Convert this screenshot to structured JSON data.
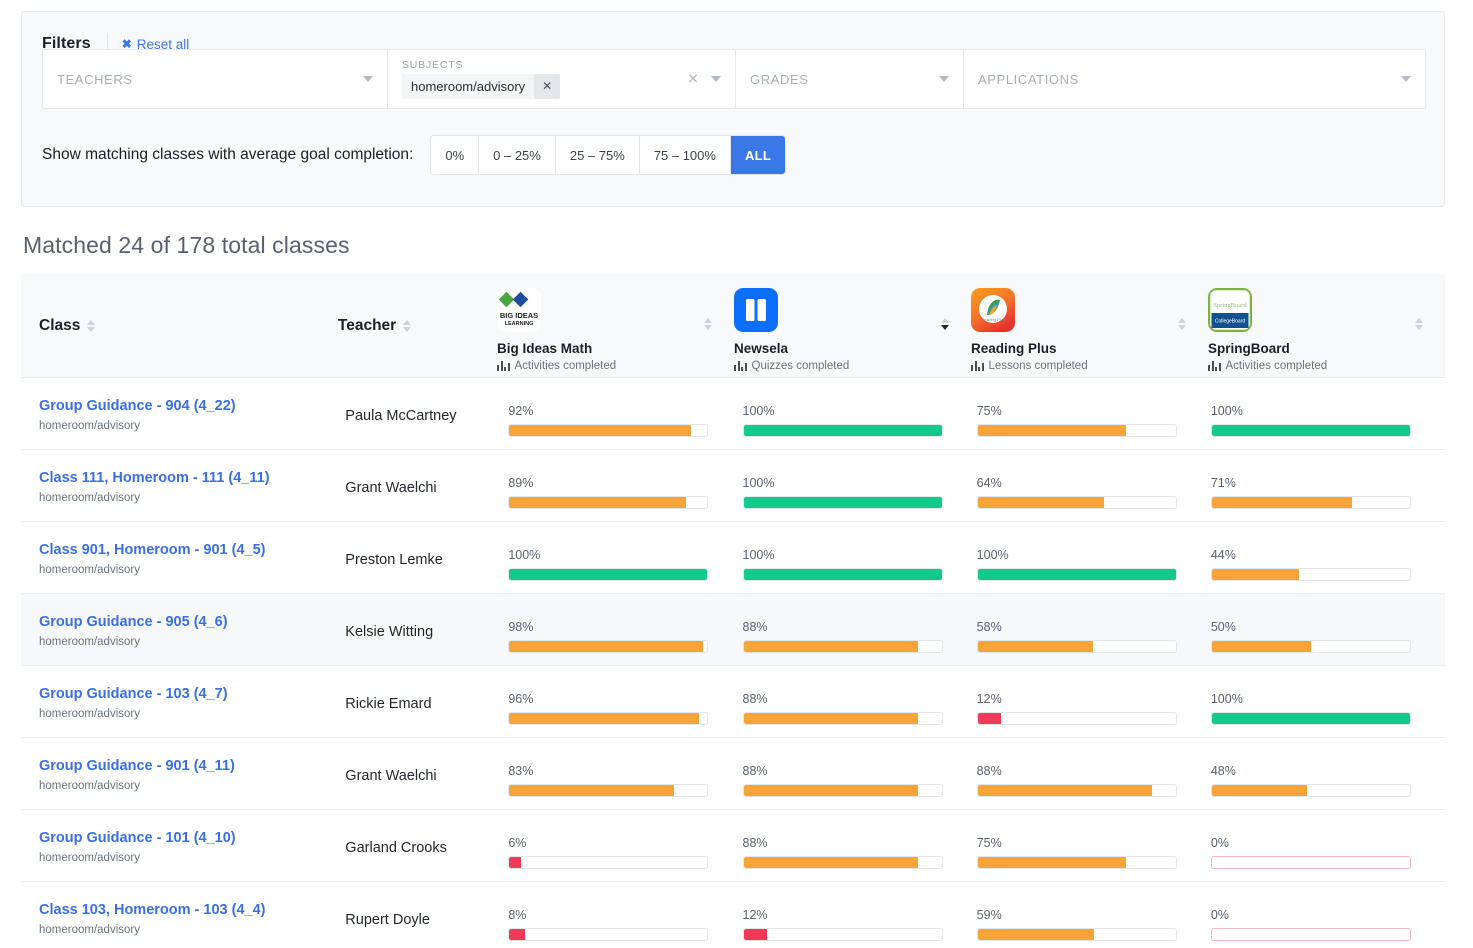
{
  "filters": {
    "title": "Filters",
    "reset_label": "Reset all",
    "reset_icon": "close-x-icon",
    "teachers_placeholder": "TEACHERS",
    "subjects_label": "SUBJECTS",
    "subjects_chip": "homeroom/advisory",
    "grades_placeholder": "GRADES",
    "applications_placeholder": "APPLICATIONS"
  },
  "completion": {
    "label": "Show matching classes with average goal completion:",
    "options": [
      "0%",
      "0 – 25%",
      "25 – 75%",
      "75 – 100%",
      "ALL"
    ],
    "selected": "ALL"
  },
  "results": {
    "matched_text": "Matched 24 of 178 total classes",
    "matched_count": 24,
    "total_count": 178
  },
  "colors": {
    "accent_blue": "#3b78e7",
    "link_blue": "#3b6fe0",
    "bar_orange": "#f5a43c",
    "bar_green": "#14c989",
    "bar_red": "#ef3b57",
    "zero_border": "#f0b9c3"
  },
  "table": {
    "columns": [
      {
        "key": "class",
        "label": "Class",
        "sort": "none"
      },
      {
        "key": "teacher",
        "label": "Teacher",
        "sort": "none"
      }
    ],
    "apps": [
      {
        "name": "Big Ideas Math",
        "metric": "Activities completed",
        "icon": "big-ideas-math-icon",
        "sort": "none"
      },
      {
        "name": "Newsela",
        "metric": "Quizzes completed",
        "icon": "newsela-icon",
        "sort": "desc"
      },
      {
        "name": "Reading Plus",
        "metric": "Lessons completed",
        "icon": "reading-plus-icon",
        "sort": "none"
      },
      {
        "name": "SpringBoard",
        "metric": "Activities completed",
        "icon": "springboard-icon",
        "sort": "none"
      }
    ],
    "rows": [
      {
        "class": "Group Guidance - 904 (4_22)",
        "subject": "homeroom/advisory",
        "teacher": "Paula McCartney",
        "values": [
          "92%",
          "100%",
          "75%",
          "100%"
        ],
        "pcts": [
          92,
          100,
          75,
          100
        ],
        "highlight": false
      },
      {
        "class": "Class 111, Homeroom - 111 (4_11)",
        "subject": "homeroom/advisory",
        "teacher": "Grant Waelchi",
        "values": [
          "89%",
          "100%",
          "64%",
          "71%"
        ],
        "pcts": [
          89,
          100,
          64,
          71
        ],
        "highlight": false
      },
      {
        "class": "Class 901, Homeroom - 901 (4_5)",
        "subject": "homeroom/advisory",
        "teacher": "Preston Lemke",
        "values": [
          "100%",
          "100%",
          "100%",
          "44%"
        ],
        "pcts": [
          100,
          100,
          100,
          44
        ],
        "highlight": false
      },
      {
        "class": "Group Guidance - 905 (4_6)",
        "subject": "homeroom/advisory",
        "teacher": "Kelsie Witting",
        "values": [
          "98%",
          "88%",
          "58%",
          "50%"
        ],
        "pcts": [
          98,
          88,
          58,
          50
        ],
        "highlight": true
      },
      {
        "class": "Group Guidance - 103 (4_7)",
        "subject": "homeroom/advisory",
        "teacher": "Rickie Emard",
        "values": [
          "96%",
          "88%",
          "12%",
          "100%"
        ],
        "pcts": [
          96,
          88,
          12,
          100
        ],
        "highlight": false
      },
      {
        "class": "Group Guidance - 901 (4_11)",
        "subject": "homeroom/advisory",
        "teacher": "Grant Waelchi",
        "values": [
          "83%",
          "88%",
          "88%",
          "48%"
        ],
        "pcts": [
          83,
          88,
          88,
          48
        ],
        "highlight": false
      },
      {
        "class": "Group Guidance - 101 (4_10)",
        "subject": "homeroom/advisory",
        "teacher": "Garland Crooks",
        "values": [
          "6%",
          "88%",
          "75%",
          "0%"
        ],
        "pcts": [
          6,
          88,
          75,
          0
        ],
        "highlight": false
      },
      {
        "class": "Class 103, Homeroom - 103 (4_4)",
        "subject": "homeroom/advisory",
        "teacher": "Rupert Doyle",
        "values": [
          "8%",
          "12%",
          "59%",
          "0%"
        ],
        "pcts": [
          8,
          12,
          59,
          0
        ],
        "highlight": false
      }
    ]
  }
}
